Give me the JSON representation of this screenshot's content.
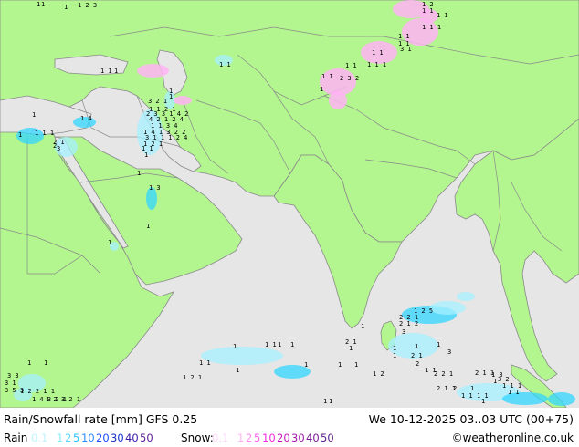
{
  "map": {
    "colors": {
      "sea": "#e6e6e6",
      "land": "#b3f58f",
      "border": "#8a8a8a",
      "rain_light": "#a6f0ff",
      "rain_mid": "#33d6ff",
      "snow": "#ffb3f5",
      "snow_mid": "#ff5cf0"
    },
    "rain_labels": [
      "1",
      "1",
      "1",
      "1 2 3",
      "1",
      "2",
      "3",
      "1 1",
      "1",
      "1 4",
      "1 1 1",
      "2 1",
      "1",
      "1",
      "1 3",
      "1",
      "1",
      "1 1",
      "3 2 1",
      "1 1 2 1",
      "2 3 3 1 4 2",
      "4 2 1 2 4",
      "1 1 3 4",
      "1 4 1 3 2 2",
      "3 1 1 1 2 4",
      "1 2 1",
      "1 1",
      "1",
      "1",
      "1 2 5",
      "2 2 1",
      "2 1 2",
      "3",
      "1",
      "2 1",
      "1",
      "1",
      "1",
      "2 1",
      "1",
      "2",
      "1 1",
      "1",
      "3",
      "1 2 1",
      "1 1",
      "1",
      "1",
      "1 1",
      "1",
      "1",
      "1",
      "2 2 1",
      "2 1 1",
      "1 3",
      "1",
      "2",
      "1 1",
      "1",
      "3 2",
      "1 1 1",
      "1 1",
      "1",
      "1 1",
      "2 1 1",
      "3 3",
      "3 1",
      "3 5 3",
      "1 2 2 1 1",
      "1 4 3 2 1",
      "1 2 3 2 1",
      "1",
      "1",
      "1",
      "1",
      "1",
      "1",
      "1 2"
    ],
    "snow_labels": [
      "1 2",
      "1 1",
      "1 1",
      "1 1 1",
      "1 1",
      "1 1",
      "3 1",
      "1 1",
      "1 1 1",
      "1 1",
      "1 1",
      "2 3 2",
      "1",
      "1"
    ]
  },
  "footer": {
    "title": "Rain/Snowfall rate [mm] GFS 0.25",
    "datetime": "We 10-12-2025 03..03 UTC (00+75)",
    "rain_label": "Rain",
    "rain_scale": [
      "0.1",
      "1",
      "2",
      "5",
      "10",
      "20",
      "30",
      "40",
      "50"
    ],
    "snow_label": "Snow:",
    "snow_scale": [
      "0.1",
      "1",
      "2",
      "5",
      "10",
      "20",
      "30",
      "40",
      "50"
    ],
    "credit": "©weatheronline.co.uk",
    "legend_colors": {
      "rain": [
        "#bff4ff",
        "#8ce8ff",
        "#5ad8ff",
        "#2bc0ff",
        "#2b8cff",
        "#1a4fff",
        "#1830c8",
        "#3a1aa8",
        "#5a1a98"
      ],
      "snow": [
        "#ffd6fb",
        "#ffb3f5",
        "#ff8cf0",
        "#ff5cf0",
        "#f02be0",
        "#c81ac0",
        "#a01aa8",
        "#7a1a98",
        "#5a1a88"
      ]
    }
  }
}
